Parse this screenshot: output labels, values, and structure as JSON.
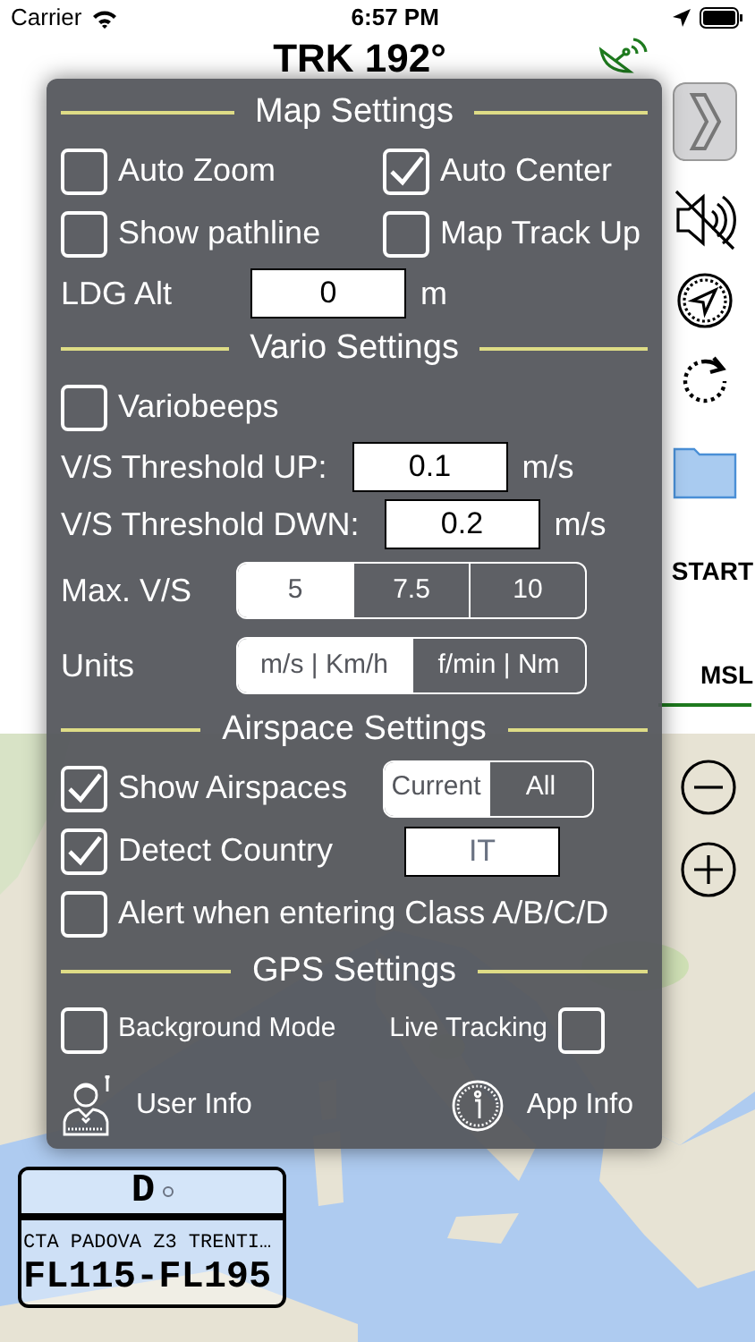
{
  "status_bar": {
    "carrier": "Carrier",
    "time": "6:57 PM"
  },
  "header": {
    "track": "TRK 192°"
  },
  "side_panel": {
    "labels": [
      "START",
      "MSL"
    ]
  },
  "settings": {
    "sections": [
      {
        "title": "Map Settings",
        "rows": [
          [
            {
              "kind": "checkbox",
              "label": "Auto Zoom",
              "checked": false
            },
            {
              "kind": "checkbox",
              "label": "Auto Center",
              "checked": true
            }
          ],
          [
            {
              "kind": "checkbox",
              "label": "Show pathline",
              "checked": false
            },
            {
              "kind": "checkbox",
              "label": "Map Track Up",
              "checked": false
            }
          ],
          [
            {
              "kind": "field",
              "label": "LDG Alt",
              "value": "0",
              "unit": "m",
              "disabled": false
            }
          ]
        ]
      },
      {
        "title": "Vario Settings",
        "rows": [
          [
            {
              "kind": "checkbox",
              "label": "Variobeeps",
              "checked": false
            }
          ],
          [
            {
              "kind": "field",
              "label": "V/S Threshold UP:",
              "value": "0.1",
              "unit": "m/s",
              "disabled": false
            }
          ],
          [
            {
              "kind": "field",
              "label": "V/S Threshold DWN:",
              "value": "0.2",
              "unit": "m/s",
              "disabled": false
            }
          ],
          [
            {
              "kind": "segmented",
              "label": "Max. V/S",
              "options": [
                {
                  "label": "5",
                  "selected": true
                },
                {
                  "label": "7.5",
                  "selected": false
                },
                {
                  "label": "10",
                  "selected": false
                }
              ]
            }
          ],
          [
            {
              "kind": "segmented",
              "label": "Units",
              "options": [
                {
                  "label": "m/s | Km/h",
                  "selected": true
                },
                {
                  "label": "f/min | Nm",
                  "selected": false
                }
              ]
            }
          ]
        ]
      },
      {
        "title": "Airspace Settings",
        "rows": [
          [
            {
              "kind": "checkbox",
              "label": "Show Airspaces",
              "checked": true
            },
            {
              "kind": "segmented",
              "options": [
                {
                  "label": "Current",
                  "selected": true
                },
                {
                  "label": "All",
                  "selected": false
                }
              ]
            }
          ],
          [
            {
              "kind": "checkbox",
              "label": "Detect Country",
              "checked": true
            },
            {
              "kind": "field",
              "value": "IT",
              "disabled": true
            }
          ],
          [
            {
              "kind": "checkbox",
              "label": "Alert when entering Class A/B/C/D",
              "checked": false
            }
          ]
        ]
      },
      {
        "title": "GPS Settings",
        "rows": [
          [
            {
              "kind": "checkbox",
              "label": "Background Mode",
              "checked": false,
              "small": true
            },
            {
              "kind": "trailing-checkbox",
              "label": "Live Tracking",
              "checked": false,
              "small": true
            }
          ]
        ]
      }
    ],
    "links": [
      {
        "label": "User Info"
      },
      {
        "label": "App Info"
      }
    ]
  },
  "airspace_card": {
    "class": "D",
    "name": "CTA PADOVA Z3 TRENTI…",
    "levels": "FL115-FL195"
  }
}
